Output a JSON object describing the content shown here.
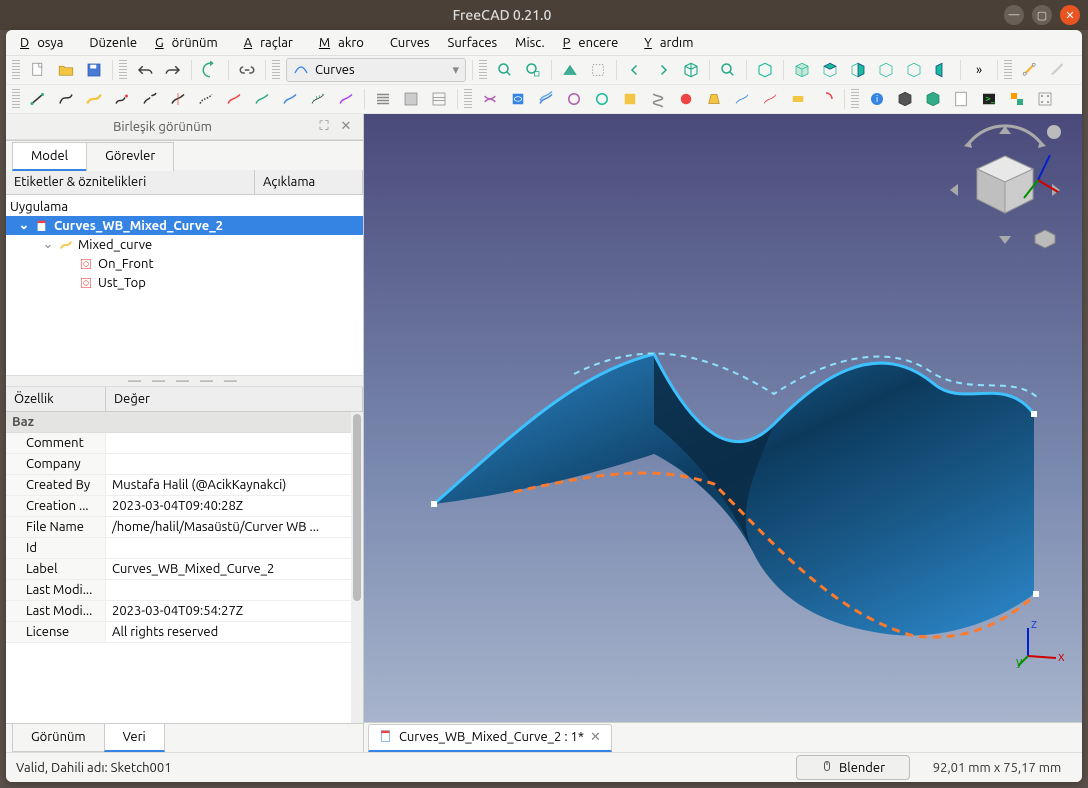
{
  "window": {
    "title": "FreeCAD 0.21.0"
  },
  "menu": {
    "file": "Dosya",
    "edit": "Düzenle",
    "view": "Görünüm",
    "tools": "Araçlar",
    "macro": "Makro",
    "curves": "Curves",
    "surfaces": "Surfaces",
    "misc": "Misc.",
    "windows": "Pencere",
    "help": "Yardım",
    "file_u": "D",
    "edit_u": "D",
    "view_u": "G",
    "tools_u": "A",
    "macro_u": "M",
    "windows_u": "P",
    "help_u": "Y"
  },
  "workbench": {
    "name": "Curves",
    "icon": "curves-wb-icon"
  },
  "panel": {
    "title": "Birleşik görünüm",
    "tabs": {
      "model": "Model",
      "tasks": "Görevler"
    },
    "tree_header": {
      "labels": "Etiketler & öznitelikleri",
      "desc": "Açıklama"
    },
    "tree": {
      "root": "Uygulama",
      "doc": "Curves_WB_Mixed_Curve_2",
      "items": [
        {
          "label": "Mixed_curve",
          "icon": "mixed-curve-icon"
        },
        {
          "label": "On_Front",
          "icon": "sketch-icon"
        },
        {
          "label": "Ust_Top",
          "icon": "sketch-icon"
        }
      ]
    },
    "splitter": "— — — — —",
    "prop_header": {
      "attr": "Özellik",
      "value": "Değer"
    },
    "prop_group": "Baz",
    "props": [
      {
        "name": "Comment",
        "value": ""
      },
      {
        "name": "Company",
        "value": ""
      },
      {
        "name": "Created By",
        "value": "Mustafa Halil (@AcikKaynakci)"
      },
      {
        "name": "Creation ...",
        "value": "2023-03-04T09:40:28Z"
      },
      {
        "name": "File Name",
        "value": "/home/halil/Masaüstü/Curver WB ..."
      },
      {
        "name": "Id",
        "value": ""
      },
      {
        "name": "Label",
        "value": "Curves_WB_Mixed_Curve_2"
      },
      {
        "name": "Last Modi...",
        "value": ""
      },
      {
        "name": "Last Modi...",
        "value": "2023-03-04T09:54:27Z"
      },
      {
        "name": "License",
        "value": "All rights reserved"
      }
    ],
    "bottom_tabs": {
      "view": "Görünüm",
      "data": "Veri"
    }
  },
  "doc_tab": {
    "label": "Curves_WB_Mixed_Curve_2 : 1*"
  },
  "status": {
    "message": "Valid, Dahili adı: Sketch001",
    "nav_style": "Blender",
    "dimensions": "92,01 mm x 75,17 mm"
  },
  "axes": {
    "x": "x",
    "y": "y",
    "z": "z"
  },
  "colors": {
    "accent": "#3584e4",
    "surface_fill": "#1f6fa8",
    "surface_dark": "#0e3a5c",
    "edge_highlight": "#3dc1ff",
    "edge_orange": "#ff7a2a"
  }
}
